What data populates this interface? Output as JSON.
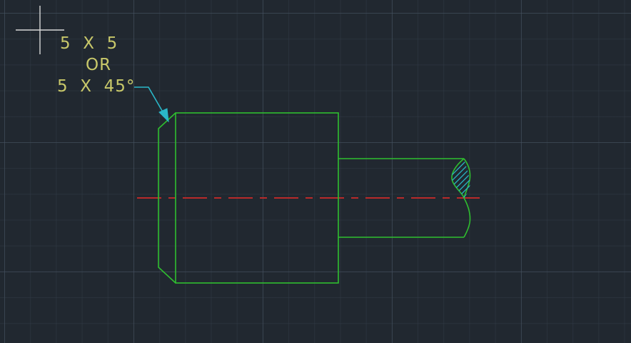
{
  "drawing": {
    "background_color": "#212830",
    "grid_color": "#46525f",
    "object_color": "#2fbf2f",
    "centerline_color": "#b82a2a",
    "leader_color": "#2ab7c8",
    "text_color": "#c8c86a",
    "crosshair_color": "#d8d8d8"
  },
  "annotation": {
    "line1": "5  X  5",
    "line2": "OR",
    "line3": "5  X  45°"
  },
  "cursor": {
    "icon": "crosshair-cursor"
  },
  "hatch": {
    "pattern": "ANSI31"
  }
}
